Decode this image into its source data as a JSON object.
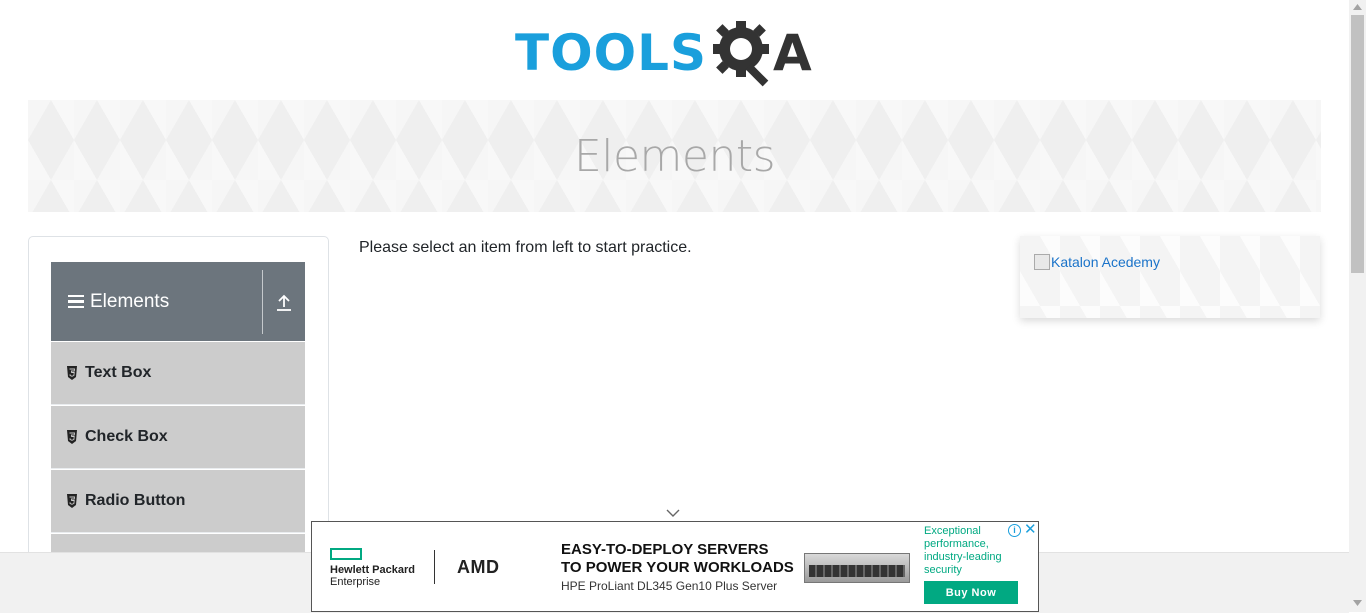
{
  "logo": {
    "text": "TOOLS",
    "suffix": "A",
    "alt": "TOOLSQA"
  },
  "banner": {
    "title": "Elements"
  },
  "sidebar": {
    "group_title": "Elements",
    "items": [
      {
        "label": "Text Box"
      },
      {
        "label": "Check Box"
      },
      {
        "label": "Radio Button"
      }
    ]
  },
  "main": {
    "instruction": "Please select an item from left to start practice."
  },
  "side_ad": {
    "alt_text": "Katalon Acedemy"
  },
  "bottom_ad": {
    "brand_line1": "Hewlett Packard",
    "brand_line2": "Enterprise",
    "partner": "AMD",
    "headline_1": "EASY-TO-DEPLOY SERVERS",
    "headline_2": "TO POWER YOUR WORKLOADS",
    "subline": "HPE ProLiant DL345 Gen10 Plus Server",
    "tagline": "Exceptional performance, industry-leading security",
    "cta": "Buy Now",
    "info_glyph": "i",
    "close_glyph": "✕"
  },
  "colors": {
    "brand_blue": "#1a9fdc",
    "header_gray": "#6c757d",
    "menu_item_bg": "#cccccc",
    "hpe_green": "#01a982"
  }
}
